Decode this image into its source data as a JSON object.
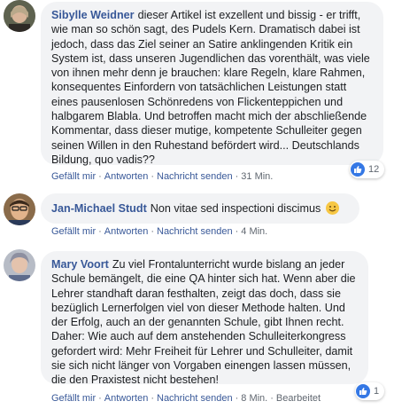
{
  "comments": [
    {
      "author": "Sibylle Weidner",
      "text": "dieser Artikel ist exzellent und bissig - er trifft, wie man so schön sagt, des Pudels Kern. Dramatisch dabei ist jedoch, dass das Ziel seiner an Satire anklingenden Kritik ein System ist, dass unseren Jugendlichen das vorenthält, was viele von ihnen mehr denn je brauchen: klare Regeln, klare Rahmen, konsequentes Einfordern von tatsächlichen Leistungen statt eines pausenlosen Schönredens von Flickenteppichen und halbgarem Blabla. Und betroffen macht mich der abschließende Kommentar, dass dieser mutige, kompetente Schulleiter gegen seinen Willen in den Ruhestand befördert wird... Deutschlands Bildung, quo vadis??",
      "reaction_count": "12",
      "actions": {
        "like": "Gefällt mir",
        "reply": "Antworten",
        "message": "Nachricht senden",
        "time": "31 Min."
      }
    },
    {
      "author": "Jan-Michael Studt",
      "text": "Non vitae sed inspectioni discimus",
      "emoji": "smiling-face-icon",
      "actions": {
        "like": "Gefällt mir",
        "reply": "Antworten",
        "message": "Nachricht senden",
        "time": "4 Min."
      }
    },
    {
      "author": "Mary Voort",
      "text": "Zu viel Frontalunterricht wurde bislang an jeder Schule bemängelt, die eine QA hinter sich hat. Wenn aber die Lehrer standhaft daran festhalten, zeigt das doch, dass sie bezüglich Lernerfolgen viel von dieser Methode halten. Und der Erfolg, auch an der genannten Schule, gibt Ihnen recht. Daher: Wie auch auf dem anstehenden Schulleiterkongress gefordert wird: Mehr Freiheit für Lehrer und Schulleiter, damit sie sich nicht länger von Vorgaben einengen lassen müssen, die den Praxistest nicht bestehen!",
      "reaction_count": "1",
      "actions": {
        "like": "Gefällt mir",
        "reply": "Antworten",
        "message": "Nachricht senden",
        "time": "8 Min.",
        "edited": "Bearbeitet"
      }
    }
  ],
  "colors": {
    "link": "#385898",
    "bubble": "#f2f3f5",
    "like_blue": "#3578e5"
  }
}
